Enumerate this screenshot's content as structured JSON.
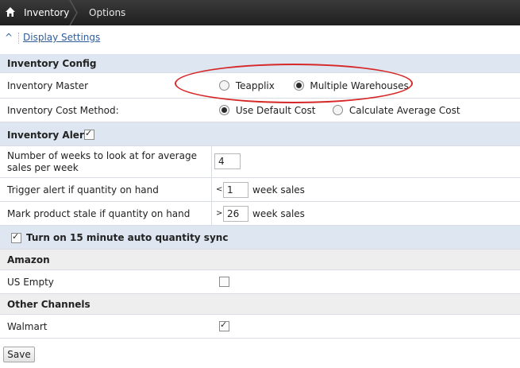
{
  "breadcrumb": {
    "home_icon": "home-icon",
    "item1": "Inventory",
    "item2": "Options"
  },
  "display_settings": {
    "caret": "^",
    "label": "Display Settings"
  },
  "inventory_config": {
    "header": "Inventory Config",
    "master": {
      "label": "Inventory Master",
      "options": [
        "Teapplix",
        "Multiple Warehouses"
      ],
      "selected": "Multiple Warehouses"
    },
    "cost_method": {
      "label": "Inventory Cost Method:",
      "options": [
        "Use Default Cost",
        "Calculate Average Cost"
      ],
      "selected": "Use Default Cost"
    }
  },
  "inventory_alerts": {
    "header": "Inventory Alerts",
    "enabled": true,
    "weeks_avg": {
      "label": "Number of weeks to look at for average sales per week",
      "value": "4"
    },
    "trigger": {
      "label": "Trigger alert if quantity on hand",
      "operator": "<",
      "value": "1",
      "suffix": "week sales"
    },
    "stale": {
      "label": "Mark product stale if quantity on hand",
      "operator": ">",
      "value": "26",
      "suffix": "week sales"
    }
  },
  "auto_sync": {
    "label": "Turn on 15 minute auto quantity sync",
    "checked": true
  },
  "amazon": {
    "header": "Amazon",
    "us_empty": {
      "label": "US Empty",
      "checked": false
    }
  },
  "other_channels": {
    "header": "Other Channels",
    "walmart": {
      "label": "Walmart",
      "checked": true
    }
  },
  "save_label": "Save",
  "colors": {
    "topbar": "#2b2b2b",
    "section_header": "#dde6f1",
    "link": "#2f5e9c",
    "annotation": "#d62828"
  }
}
